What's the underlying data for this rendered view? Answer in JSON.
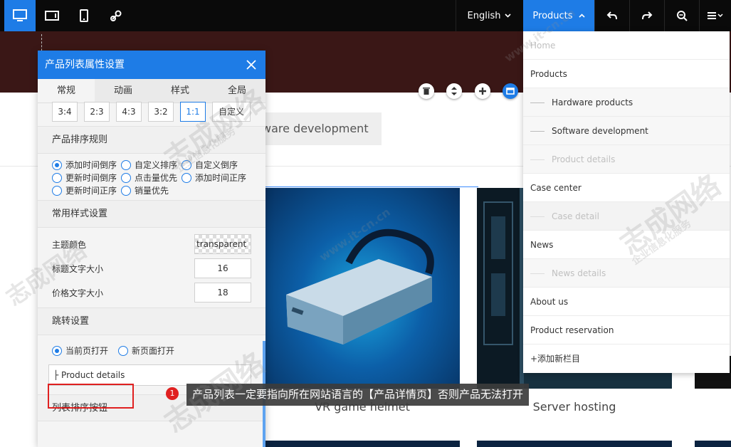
{
  "toolbar": {
    "devices": [
      {
        "name": "desktop-icon",
        "active": true
      },
      {
        "name": "tablet-icon",
        "active": false
      },
      {
        "name": "mobile-icon",
        "active": false
      },
      {
        "name": "link-icon",
        "active": false
      }
    ],
    "language_label": "English",
    "products_label": "Products",
    "tools": [
      "undo-icon",
      "redo-icon",
      "zoom-out-icon",
      "menu-icon"
    ],
    "accent": "#1e7ce6"
  },
  "page": {
    "tab_button_label": "ware development",
    "products": [
      {
        "caption": "VR game helmet"
      },
      {
        "caption": "Server hosting"
      }
    ],
    "controls": [
      "delete-icon",
      "move-icon",
      "add-icon",
      "window-icon"
    ]
  },
  "panel": {
    "title": "产品列表属性设置",
    "tabs": [
      {
        "label": "常规",
        "active": true
      },
      {
        "label": "动画",
        "active": false
      },
      {
        "label": "样式",
        "active": false
      },
      {
        "label": "全局",
        "active": false
      }
    ],
    "ratios": [
      {
        "label": "3:4",
        "active": false
      },
      {
        "label": "2:3",
        "active": false
      },
      {
        "label": "4:3",
        "active": false
      },
      {
        "label": "3:2",
        "active": false
      },
      {
        "label": "1:1",
        "active": true
      },
      {
        "label": "自定义",
        "active": false
      }
    ],
    "sort_title": "产品排序规则",
    "sort_options": [
      {
        "label": "添加时间倒序",
        "checked": true
      },
      {
        "label": "自定义排序",
        "checked": false
      },
      {
        "label": "自定义倒序",
        "checked": false
      },
      {
        "label": "更新时间倒序",
        "checked": false
      },
      {
        "label": "点击量优先",
        "checked": false
      },
      {
        "label": "添加时间正序",
        "checked": false
      },
      {
        "label": "更新时间正序",
        "checked": false
      },
      {
        "label": "销量优先",
        "checked": false
      }
    ],
    "style_title": "常用样式设置",
    "style_rows": {
      "theme_color_label": "主题颜色",
      "theme_color_value": "transparent",
      "title_size_label": "标题文字大小",
      "title_size_value": "16",
      "price_size_label": "价格文字大小",
      "price_size_value": "18"
    },
    "jump_title": "跳转设置",
    "jump_options": [
      {
        "label": "当前页打开",
        "checked": true
      },
      {
        "label": "新页面打开",
        "checked": false
      }
    ],
    "link_value": "├ Product details",
    "list_sort_title": "列表排序按钮"
  },
  "annotation": {
    "badge": "1",
    "tooltip": "产品列表一定要指向所在网站语言的【产品详情页】否则产品无法打开",
    "highlight_color": "#e02020"
  },
  "dropdown": {
    "items": [
      {
        "label": "Home",
        "level": 0,
        "dim": true
      },
      {
        "label": "Products",
        "level": 0,
        "dim": false
      },
      {
        "label": "Hardware products",
        "level": 1,
        "dim": false
      },
      {
        "label": "Software development",
        "level": 1,
        "dim": false
      },
      {
        "label": "Product details",
        "level": 1,
        "dim": true
      },
      {
        "label": "Case center",
        "level": 0,
        "dim": false
      },
      {
        "label": "Case detail",
        "level": 1,
        "dim": true
      },
      {
        "label": "News",
        "level": 0,
        "dim": false
      },
      {
        "label": "News details",
        "level": 1,
        "dim": true
      },
      {
        "label": "About us",
        "level": 0,
        "dim": false
      },
      {
        "label": "Product reservation",
        "level": 0,
        "dim": false
      },
      {
        "label": "+添加新栏目",
        "level": 0,
        "dim": false
      }
    ]
  },
  "watermark": {
    "brand": "志成网络",
    "url": "www.it-cn.cn",
    "slogan": "企业信息化服务"
  }
}
